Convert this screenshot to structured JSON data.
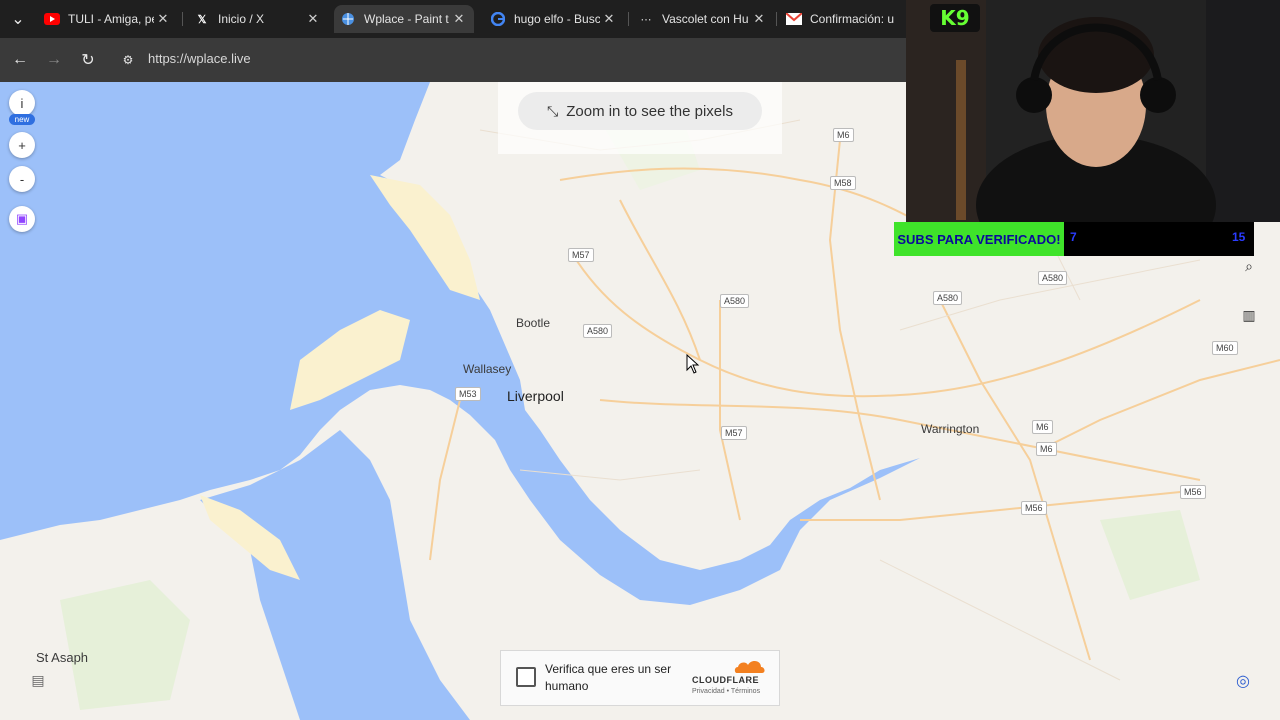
{
  "browser": {
    "tabs": [
      {
        "icon": "youtube-icon",
        "title": "TULI - Amiga, pe"
      },
      {
        "icon": "x-icon",
        "title": "Inicio / X"
      },
      {
        "icon": "globe-icon",
        "title": "Wplace - Paint t"
      },
      {
        "icon": "google-icon",
        "title": "hugo elfo - Busc"
      },
      {
        "icon": "dots-icon",
        "title": "Vascolet con Hu"
      },
      {
        "icon": "gmail-icon",
        "title": "Confirmación: u"
      }
    ],
    "url": "https://wplace.live"
  },
  "sidebar": {
    "info_label": "i",
    "new_badge": "new",
    "zoom_in_label": "+",
    "zoom_out_label": "-"
  },
  "banner": {
    "text": "Zoom in to see the pixels"
  },
  "map": {
    "places": {
      "bootle": "Bootle",
      "wallasey": "Wallasey",
      "liverpool": "Liverpool",
      "warrington": "Warrington",
      "st_asaph": "St Asaph"
    },
    "roads": {
      "m6_top": "M6",
      "m58": "M58",
      "m57_top": "M57",
      "a580_1": "A580",
      "a580_2": "A580",
      "a580_3": "A580",
      "a580_4": "A580",
      "m60": "M60",
      "m53": "M53",
      "m57_bottom": "M57",
      "m6_mid": "M6",
      "m6_low": "M6",
      "m56_right": "M56",
      "m56_mid": "M56"
    },
    "colors": {
      "land": "#f3f1ec",
      "water": "#9cc0f9",
      "beach": "#faf1cf",
      "green": "#e6f0d9",
      "roads": "#f6cf9a"
    }
  },
  "overlay": {
    "webcam_badge": "9",
    "subs_text": "SUBS PARA VERIFICADO!",
    "subs_count_left": "7",
    "subs_count_right": "15"
  },
  "captcha": {
    "text": "Verifica que eres un ser humano",
    "brand": "CLOUDFLARE",
    "links": "Privacidad • Términos"
  }
}
